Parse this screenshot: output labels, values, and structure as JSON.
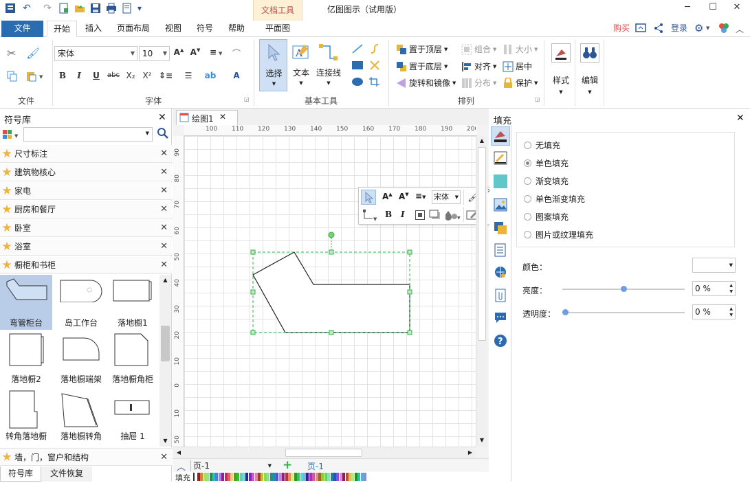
{
  "app": {
    "title": "亿图图示（试用版）",
    "doc_tools": "文档工具"
  },
  "menu": {
    "file": "文件",
    "tabs": [
      "开始",
      "插入",
      "页面布局",
      "视图",
      "符号",
      "帮助"
    ],
    "floor_plan": "平面图",
    "buy": "购买",
    "login": "登录"
  },
  "ribbon": {
    "groups": {
      "file": "文件",
      "font": "字体",
      "basic_tools": "基本工具",
      "arrange": "排列"
    },
    "font_name": "宋体",
    "font_size": "10",
    "select": "选择",
    "text": "文本",
    "connector": "连接线",
    "bring_to_front": "置于顶层",
    "send_to_back": "置于底层",
    "rotate_flip": "旋转和镜像",
    "group": "组合",
    "align": "对齐",
    "distribute": "分布",
    "size": "大小",
    "center": "居中",
    "protect": "保护",
    "style": "样式",
    "edit": "编辑"
  },
  "left_panel": {
    "title": "符号库",
    "libraries": [
      "尺寸标注",
      "建筑物核心",
      "家电",
      "厨房和餐厅",
      "卧室",
      "浴室",
      "橱柜和书柜"
    ],
    "shapes": [
      "弯管柜台",
      "岛工作台",
      "落地橱1",
      "落地橱2",
      "落地橱端架",
      "落地橱角柜",
      "转角落地橱",
      "落地橱转角",
      "抽屉 1"
    ],
    "bottom_library": "墙，门，窗户和结构",
    "bottom_tabs": [
      "符号库",
      "文件恢复"
    ]
  },
  "canvas": {
    "tab": "绘图1",
    "ruler_h": [
      "100",
      "110",
      "120",
      "130",
      "140",
      "150",
      "160",
      "170",
      "180",
      "190",
      "200"
    ],
    "ruler_v": [
      "90",
      "80",
      "70",
      "60",
      "50",
      "40",
      "30",
      "20",
      "10",
      "0",
      "10",
      "50"
    ],
    "page_select": "页-1",
    "page_tab": "页-1",
    "fill_label": "填充"
  },
  "floating_toolbar": {
    "font": "宋体"
  },
  "fill_panel": {
    "title": "填充",
    "options": [
      "无填充",
      "单色填充",
      "渐变填充",
      "单色渐变填充",
      "图案填充",
      "图片或纹理填充"
    ],
    "selected": "单色填充",
    "color_label": "颜色：",
    "brightness_label": "亮度：",
    "brightness_value": "0 %",
    "brightness_level": 0.5,
    "transparency_label": "透明度：",
    "transparency_value": "0 %",
    "transparency_level": 0.0
  },
  "colors": {
    "accent": "#2b6cb0",
    "selection": "#2fb34a",
    "buy": "#d9534f"
  }
}
